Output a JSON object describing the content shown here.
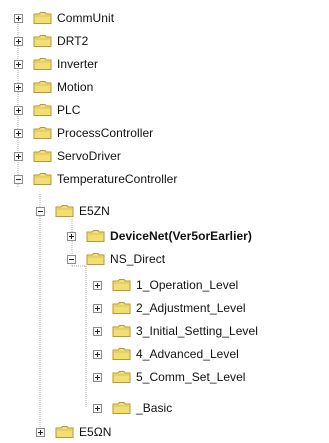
{
  "tree": {
    "nodes": [
      {
        "label": "CommUnit",
        "state": "collapsed",
        "bold": false
      },
      {
        "label": "DRT2",
        "state": "collapsed",
        "bold": false
      },
      {
        "label": "Inverter",
        "state": "collapsed",
        "bold": false
      },
      {
        "label": "Motion",
        "state": "collapsed",
        "bold": false
      },
      {
        "label": "PLC",
        "state": "collapsed",
        "bold": false
      },
      {
        "label": "ProcessController",
        "state": "collapsed",
        "bold": false
      },
      {
        "label": "ServoDriver",
        "state": "collapsed",
        "bold": false
      },
      {
        "label": "TemperatureController",
        "state": "expanded",
        "bold": false
      },
      {
        "label": "E5ZN",
        "state": "expanded",
        "bold": false
      },
      {
        "label": "DeviceNet(Ver5orEarlier)",
        "state": "collapsed",
        "bold": true
      },
      {
        "label": "NS_Direct",
        "state": "expanded",
        "bold": false
      },
      {
        "label": "1_Operation_Level",
        "state": "collapsed",
        "bold": false
      },
      {
        "label": "2_Adjustment_Level",
        "state": "collapsed",
        "bold": false
      },
      {
        "label": "3_Initial_Setting_Level",
        "state": "collapsed",
        "bold": false
      },
      {
        "label": "4_Advanced_Level",
        "state": "collapsed",
        "bold": false
      },
      {
        "label": "5_Comm_Set_Level",
        "state": "collapsed",
        "bold": false
      },
      {
        "label": "_Basic",
        "state": "collapsed",
        "bold": false
      },
      {
        "label": "E5ΩN",
        "state": "collapsed",
        "bold": false
      }
    ]
  },
  "colors": {
    "folder_fill": "#f2de74",
    "folder_edge": "#b59a2e",
    "guide_line": "#a9a9a9",
    "expander_border": "#8c8c8c",
    "text": "#111111"
  },
  "icons": {
    "expander_collapsed": "plus-box-icon",
    "expander_expanded": "minus-box-icon",
    "folder": "folder-icon"
  }
}
